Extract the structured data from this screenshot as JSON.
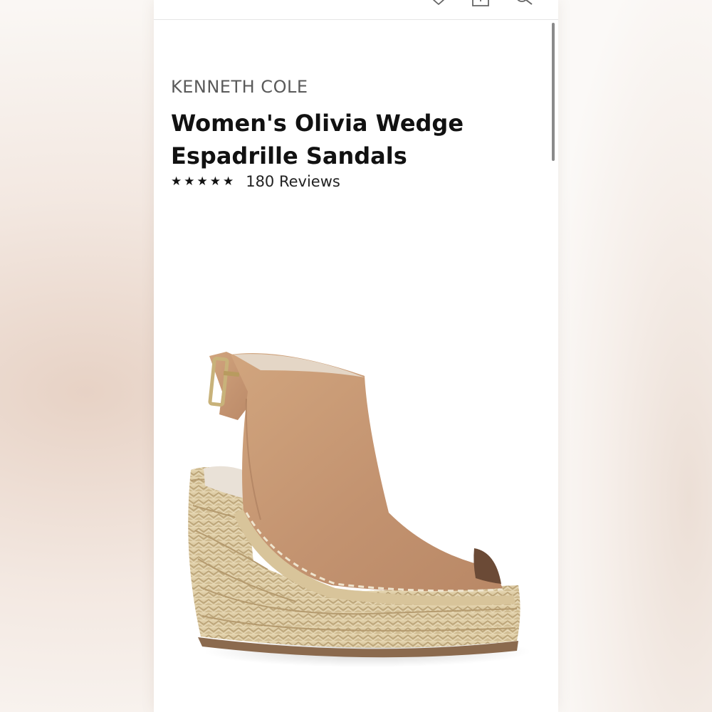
{
  "header": {
    "back_icon": "chevron-left-icon",
    "favorite_icon": "heart-icon",
    "share_icon": "share-icon",
    "search_icon": "search-icon"
  },
  "product": {
    "brand": "KENNETH COLE",
    "title_line1": "Women's Olivia Wedge",
    "title_line2": "Espadrille Sandals",
    "stars": "★★★★★",
    "rating_out_of_5": 5,
    "reviews": "180 Reviews",
    "image": "tan-suede-wedge-espadrille-sandal"
  },
  "colors": {
    "suede": "#c99a72",
    "jute": "#ddc9a0",
    "text": "#111111",
    "brand_text": "#5a5a5a"
  }
}
